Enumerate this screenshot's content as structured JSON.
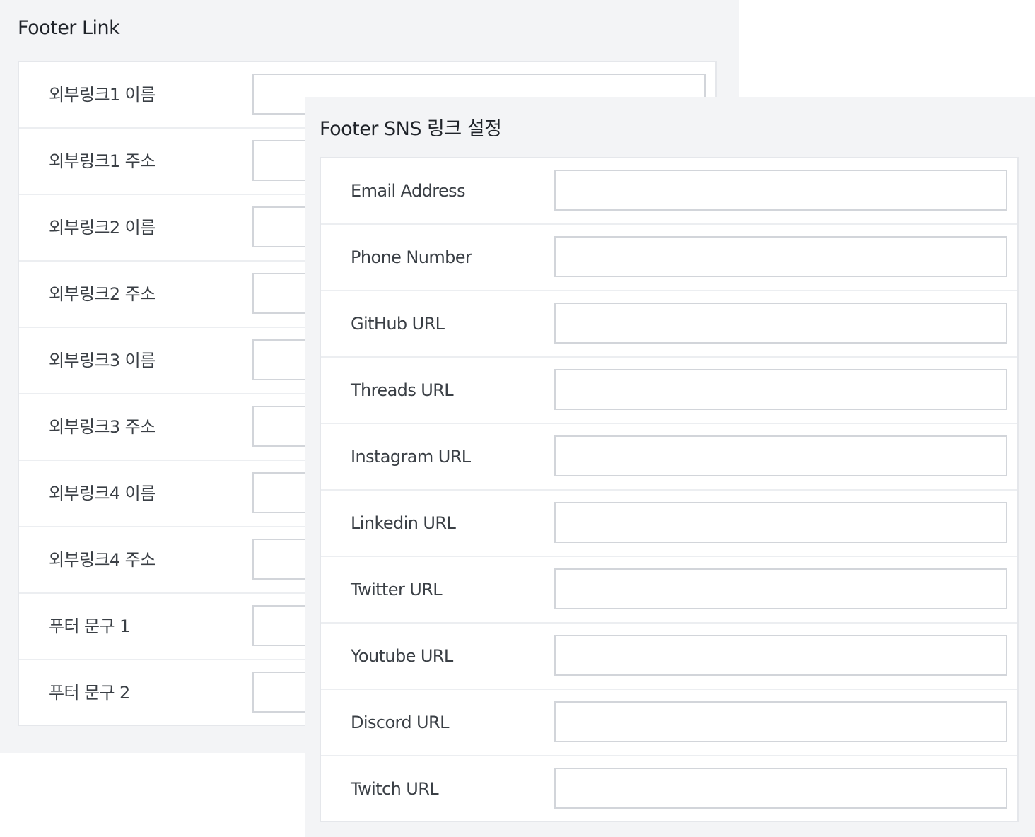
{
  "footer_link_panel": {
    "title": "Footer Link",
    "rows": [
      {
        "label": "외부링크1 이름",
        "value": ""
      },
      {
        "label": "외부링크1 주소",
        "value": ""
      },
      {
        "label": "외부링크2 이름",
        "value": ""
      },
      {
        "label": "외부링크2 주소",
        "value": ""
      },
      {
        "label": "외부링크3 이름",
        "value": ""
      },
      {
        "label": "외부링크3 주소",
        "value": ""
      },
      {
        "label": "외부링크4 이름",
        "value": ""
      },
      {
        "label": "외부링크4 주소",
        "value": ""
      },
      {
        "label": "푸터 문구 1",
        "value": ""
      },
      {
        "label": "푸터 문구 2",
        "value": ""
      }
    ]
  },
  "sns_panel": {
    "title": "Footer SNS 링크 설정",
    "rows": [
      {
        "label": "Email Address",
        "value": ""
      },
      {
        "label": "Phone Number",
        "value": ""
      },
      {
        "label": "GitHub URL",
        "value": ""
      },
      {
        "label": "Threads URL",
        "value": ""
      },
      {
        "label": "Instagram URL",
        "value": ""
      },
      {
        "label": "Linkedin URL",
        "value": ""
      },
      {
        "label": "Twitter URL",
        "value": ""
      },
      {
        "label": "Youtube URL",
        "value": ""
      },
      {
        "label": "Discord URL",
        "value": ""
      },
      {
        "label": "Twitch URL",
        "value": ""
      }
    ]
  }
}
